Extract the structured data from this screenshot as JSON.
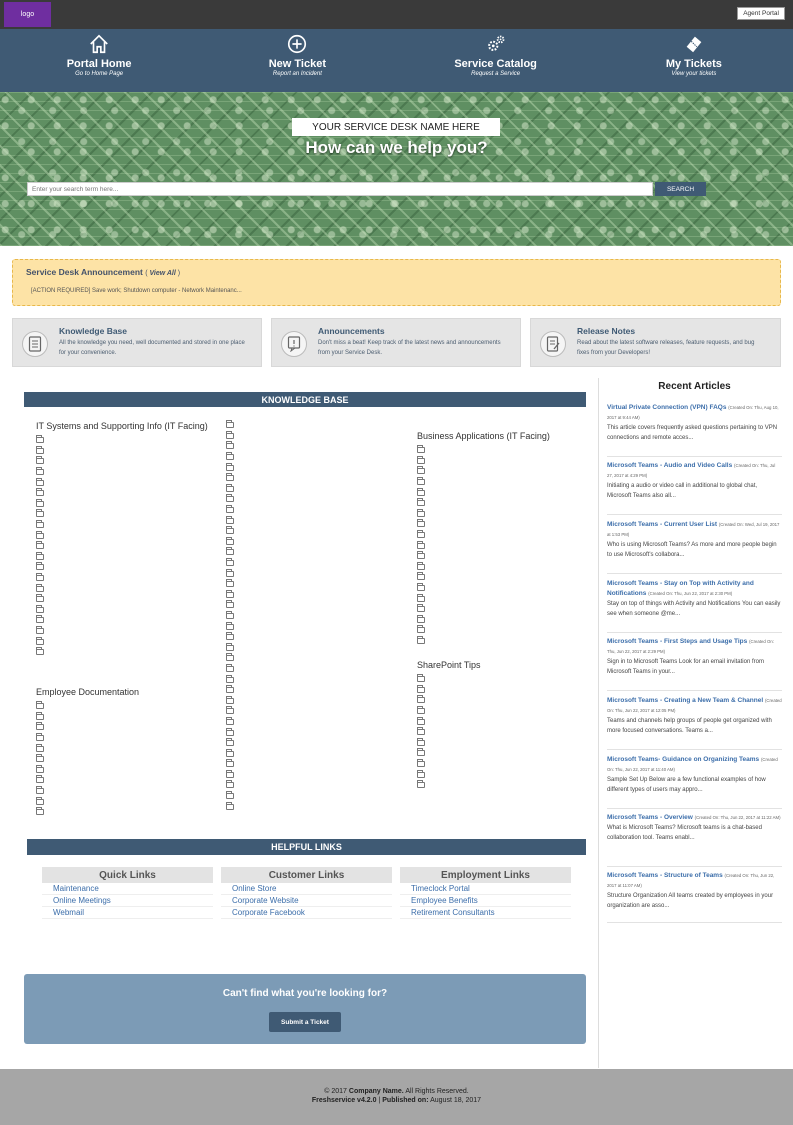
{
  "topbar": {
    "logo": "logo",
    "agent_portal": "Agent Portal"
  },
  "nav": [
    {
      "icon": "home-icon",
      "title": "Portal Home",
      "subtitle": "Go to Home Page"
    },
    {
      "icon": "plus-circle-icon",
      "title": "New Ticket",
      "subtitle": "Report an Incident"
    },
    {
      "icon": "gears-icon",
      "title": "Service Catalog",
      "subtitle": "Request a Service"
    },
    {
      "icon": "ticket-icon",
      "title": "My Tickets",
      "subtitle": "View your tickets"
    }
  ],
  "hero": {
    "desk_name": "YOUR SERVICE DESK NAME HERE",
    "title": "How can we help you?",
    "search_placeholder": "Enter your search term here...",
    "search_button": "SEARCH"
  },
  "announcement": {
    "title": "Service Desk Announcement",
    "view_all": "View All",
    "text": "[ACTION REQUIRED] Save work; Shutdown computer - Network Maintenanc..."
  },
  "cards": [
    {
      "icon": "book-icon",
      "title": "Knowledge Base",
      "desc": "All the knowledge you need, well documented and stored in one place for your convenience."
    },
    {
      "icon": "announcement-icon",
      "title": "Announcements",
      "desc": "Don't miss a beat! Keep track of the latest news and announcements from your Service Desk."
    },
    {
      "icon": "release-notes-icon",
      "title": "Release Notes",
      "desc": "Read about the latest software releases, feature requests, and bug fixes from your Developers!"
    }
  ],
  "kb": {
    "heading": "KNOWLEDGE BASE",
    "categories": {
      "it_systems": "IT Systems and Supporting Info (IT Facing)",
      "employee_docs": "Employee Documentation",
      "business_apps": "Business Applications (IT Facing)",
      "sharepoint": "SharePoint Tips"
    }
  },
  "recent": {
    "heading": "Recent Articles",
    "articles": [
      {
        "title": "Virtual Private Connection (VPN) FAQs",
        "meta": "(Created On: Thu, Aug 10, 2017 at 9:44 AM)",
        "excerpt": "This article covers frequently asked questions pertaining to VPN connections and remote acces..."
      },
      {
        "title": "Microsoft Teams - Audio and Video Calls",
        "meta": "(Created On: Thu, Jul 27, 2017 at 4:29 PM)",
        "excerpt": "Initiating a audio or video call in additional to global chat, Microsoft Teams also all..."
      },
      {
        "title": "Microsoft Teams - Current User List",
        "meta": "(Created On: Wed, Jul 19, 2017 at 1:53 PM)",
        "excerpt": "Who is using Microsoft Teams?   As more and more people begin to use Microsoft's collabora..."
      },
      {
        "title": "Microsoft Teams - Stay on Top with Activity and Notifications",
        "meta": "(Created On: Thu, Jun 22, 2017 at 2:30 PM)",
        "excerpt": "   Stay on top of things with Activity and Notifications You can easily see when someone @me..."
      },
      {
        "title": "Microsoft Teams - First Steps and Usage Tips",
        "meta": "(Created On: Thu, Jun 22, 2017 at 2:29 PM)",
        "excerpt": "Sign in to Microsoft Teams Look for an email invitation from Microsoft Teams in your..."
      },
      {
        "title": "Microsoft Teams - Creating a New Team & Channel",
        "meta": "(Created On: Thu, Jun 22, 2017 at 12:05 PM)",
        "excerpt": "Teams and channels help groups of people get organized with more focused conversations.  Teams a..."
      },
      {
        "title": "Microsoft Teams- Guidance on Organizing Teams",
        "meta": "(Created On: Thu, Jun 22, 2017 at 11:40 AM)",
        "excerpt": "Sample Set Up Below are a few functional examples of how different types of users may appro..."
      },
      {
        "title": "Microsoft Teams - Overview",
        "meta": "(Created On: Thu, Jun 22, 2017 at 11:22 AM)",
        "excerpt": "What is Microsoft Teams? Microsoft teams is a chat-based collaboration tool. Teams enabl..."
      },
      {
        "title": "Microsoft Teams - Structure of Teams",
        "meta": "(Created On: Thu, Jun 22, 2017 at 11:07 AM)",
        "excerpt": "Structure Organization  All teams created by employees in your organization are asso..."
      }
    ]
  },
  "helpful": {
    "heading": "HELPFUL LINKS",
    "columns": [
      {
        "title": "Quick Links",
        "links": [
          "Maintenance",
          "Online Meetings",
          "Webmail"
        ]
      },
      {
        "title": "Customer Links",
        "links": [
          "Online Store",
          "Corporate Website",
          "Corporate Facebook"
        ]
      },
      {
        "title": "Employment Links",
        "links": [
          "Timeclock Portal",
          "Employee Benefits",
          "Retirement Consultants"
        ]
      }
    ]
  },
  "cantfind": {
    "text": "Can't find what you're looking for?",
    "button": "Submit a Ticket"
  },
  "footer": {
    "copyright": "© 2017",
    "company": "Company Name.",
    "rights": "All Rights Reserved.",
    "version": "Freshservice v4.2.0",
    "sep": "|",
    "published_label": "Published on:",
    "published_date": "August 18, 2017"
  },
  "colors": {
    "nav_bg": "#3f5a74",
    "logo_bg": "#6f2ea0",
    "link": "#3c6eaa",
    "announce_bg": "#fde3a6",
    "cantfind_bg": "#7c9bb6"
  }
}
